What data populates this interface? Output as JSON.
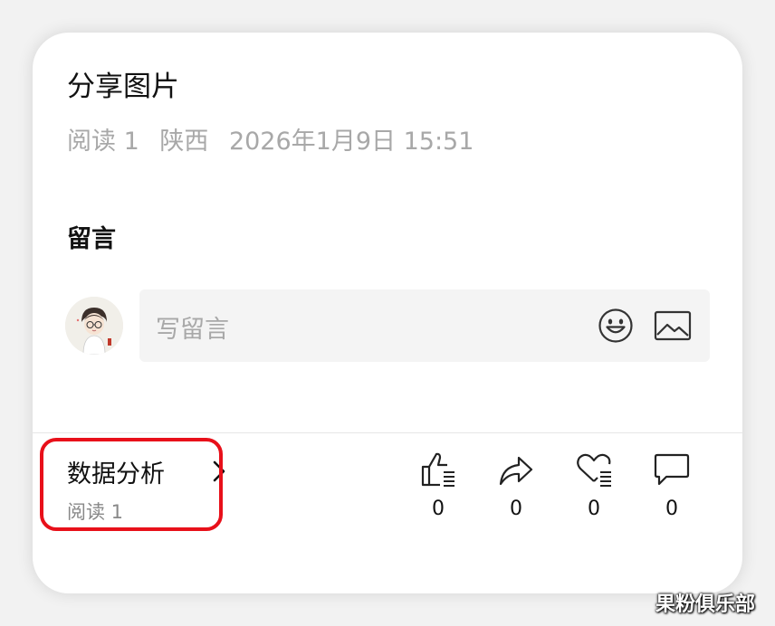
{
  "post": {
    "title": "分享图片",
    "meta": {
      "read_label": "阅读 1",
      "location": "陕西",
      "datetime": "2026年1月9日 15:51"
    }
  },
  "comments": {
    "section_title": "留言",
    "input_placeholder": "写留言",
    "emoji_icon": "smiley-face-icon",
    "image_icon": "image-icon"
  },
  "footer": {
    "analysis": {
      "title": "数据分析",
      "chevron_icon": "chevron-right-icon",
      "subtitle": "阅读 1"
    },
    "actions": [
      {
        "name": "like",
        "icon": "thumbs-up-icon",
        "count": "0"
      },
      {
        "name": "share",
        "icon": "share-arrow-icon",
        "count": "0"
      },
      {
        "name": "favorite",
        "icon": "heart-list-icon",
        "count": "0"
      },
      {
        "name": "comment",
        "icon": "speech-bubble-icon",
        "count": "0"
      }
    ]
  },
  "highlight_color": "#e8101a",
  "watermark": "果粉俱乐部"
}
